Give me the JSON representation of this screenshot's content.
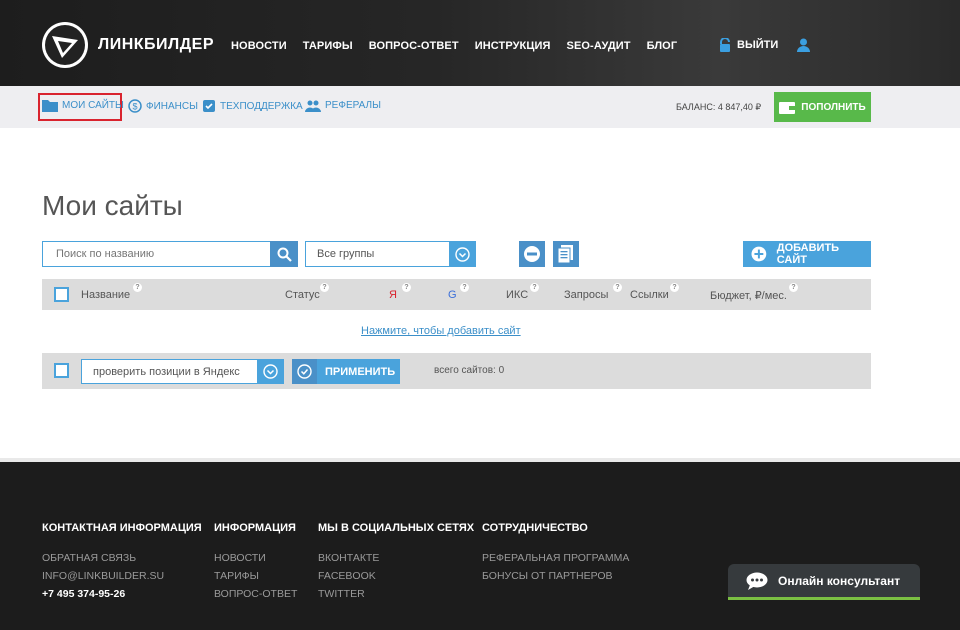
{
  "brand": {
    "name": "ЛИНКБИЛДЕР"
  },
  "nav": {
    "items": [
      "НОВОСТИ",
      "ТАРИФЫ",
      "ВОПРОС-ОТВЕТ",
      "ИНСТРУКЦИЯ",
      "SEO-АУДИТ",
      "БЛОГ"
    ],
    "logout": "ВЫЙТИ"
  },
  "subnav": {
    "items": [
      "МОИ САЙТЫ",
      "ФИНАНСЫ",
      "ТЕХПОДДЕРЖКА",
      "РЕФЕРАЛЫ"
    ],
    "active": "МОИ САЙТЫ",
    "balance": "БАЛАНС: 4 847,40 ₽",
    "topup": "ПОПОЛНИТЬ"
  },
  "main": {
    "title": "Мои сайты",
    "search_placeholder": "Поиск по названию",
    "group_select": "Все группы",
    "add_site": "ДОБАВИТЬ САЙТ",
    "columns": [
      "Название",
      "Статус",
      "Я",
      "G",
      "ИКС",
      "Запросы",
      "Ссылки",
      "Бюджет, ₽/мес."
    ],
    "empty_link": "Нажмите, чтобы добавить сайт",
    "action_select": "проверить позиции в Яндекс",
    "apply": "ПРИМЕНИТЬ",
    "total": "всего сайтов: 0"
  },
  "footer": {
    "contact": {
      "title": "КОНТАКТНАЯ ИНФОРМАЦИЯ",
      "items": [
        "ОБРАТНАЯ СВЯЗЬ",
        "INFO@LINKBUILDER.SU"
      ],
      "phone": "+7 495 374-95-26"
    },
    "info": {
      "title": "ИНФОРМАЦИЯ",
      "items": [
        "НОВОСТИ",
        "ТАРИФЫ",
        "ВОПРОС-ОТВЕТ"
      ]
    },
    "social": {
      "title": "МЫ В СОЦИАЛЬНЫХ СЕТЯХ",
      "items": [
        "ВКОНТАКТЕ",
        "FACEBOOK",
        "TWITTER"
      ]
    },
    "partners": {
      "title": "СОТРУДНИЧЕСТВО",
      "items": [
        "РЕФЕРАЛЬНАЯ ПРОГРАММА",
        "БОНУСЫ ОТ ПАРТНЕРОВ"
      ]
    }
  },
  "chat": {
    "label": "Онлайн консультант"
  },
  "colors": {
    "accent": "#4aa3dc",
    "green": "#58b94a",
    "active_outline": "#d9232e"
  }
}
